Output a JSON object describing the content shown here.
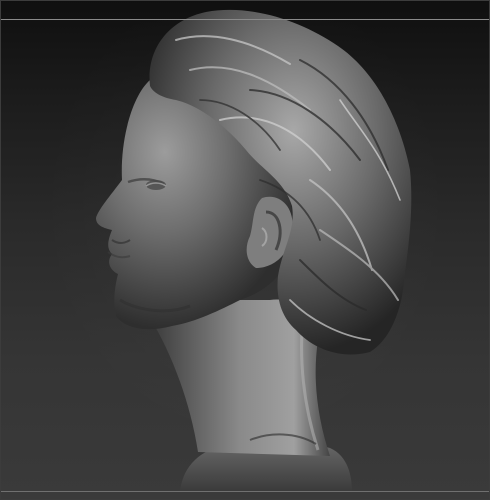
{
  "viewport": {
    "background_top": "#0f0f0f",
    "background_bottom": "#3a3a3a",
    "material_color": "#7a7a7a",
    "subject": "clay-bust-profile"
  }
}
